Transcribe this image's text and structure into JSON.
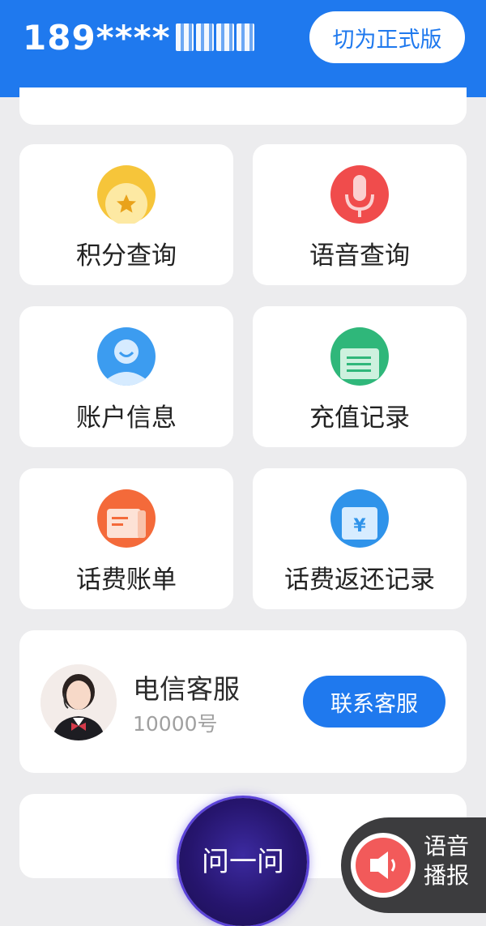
{
  "header": {
    "phone_prefix": "189****",
    "switch_label": "切为正式版",
    "bg_color": "#1f79ee"
  },
  "tiles": [
    {
      "label": "积分查询",
      "icon": "points-medal-icon"
    },
    {
      "label": "语音查询",
      "icon": "microphone-icon"
    },
    {
      "label": "账户信息",
      "icon": "user-account-icon"
    },
    {
      "label": "充值记录",
      "icon": "recharge-record-icon"
    },
    {
      "label": "话费账单",
      "icon": "bill-icon"
    },
    {
      "label": "话费返还记录",
      "icon": "yuan-refund-icon"
    }
  ],
  "service": {
    "title": "电信客服",
    "number": "10000号",
    "contact_label": "联系客服"
  },
  "ask_label": "问一问",
  "voice": {
    "label_line1": "语音",
    "label_line2": "播报"
  }
}
